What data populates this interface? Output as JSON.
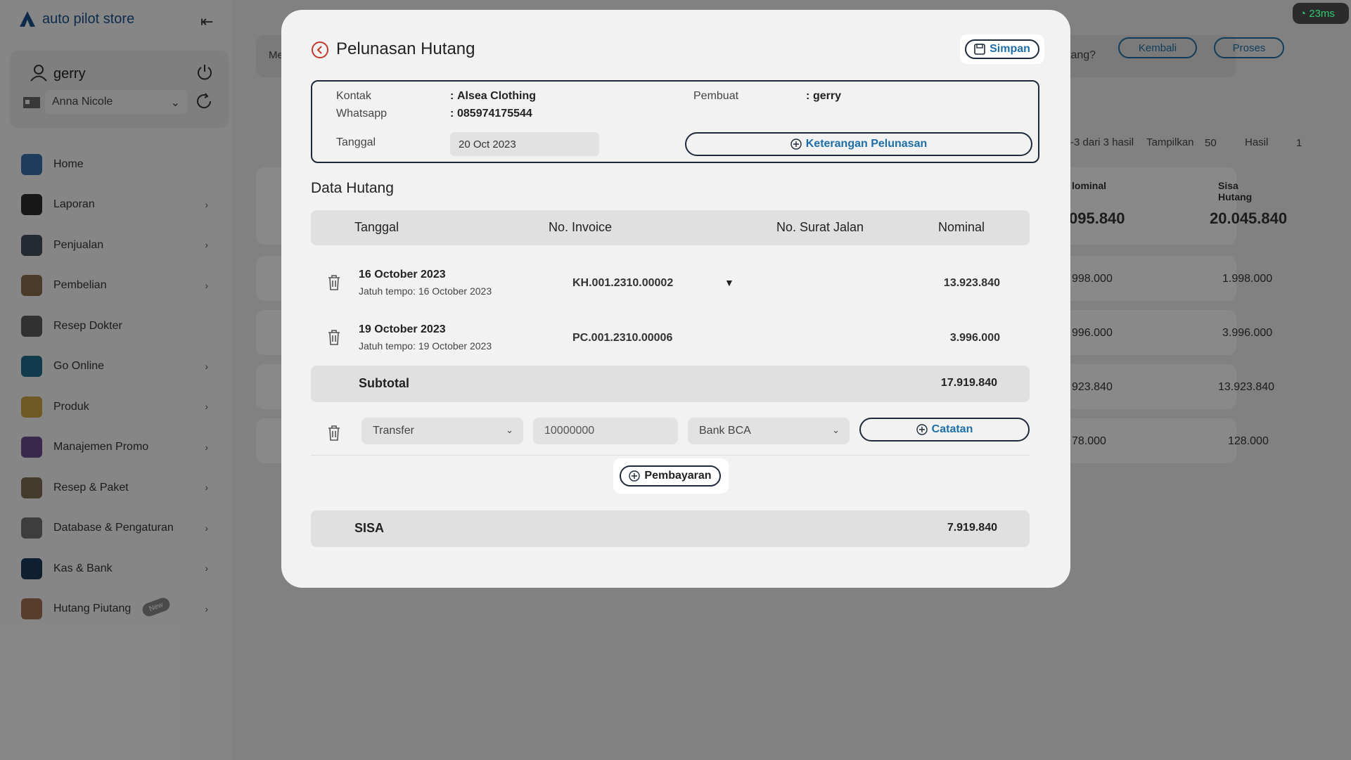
{
  "app": {
    "logo_text": "auto pilot store",
    "network": "23ms"
  },
  "user": {
    "name": "gerry",
    "store": "Anna Nicole"
  },
  "sidebar": {
    "items": [
      {
        "label": "Home",
        "icon": "home-icon",
        "color": "#3b6ea8",
        "arrow": false
      },
      {
        "label": "Laporan",
        "icon": "report-icon",
        "color": "#2a2a2a",
        "arrow": true
      },
      {
        "label": "Penjualan",
        "icon": "cashier-icon",
        "color": "#444c5a",
        "arrow": true
      },
      {
        "label": "Pembelian",
        "icon": "purchase-icon",
        "color": "#8a6a4a",
        "arrow": true
      },
      {
        "label": "Resep Dokter",
        "icon": "prescription-icon",
        "color": "#5a5a5a",
        "arrow": false
      },
      {
        "label": "Go Online",
        "icon": "monitor-icon",
        "color": "#1f6a8a",
        "arrow": true
      },
      {
        "label": "Produk",
        "icon": "box-icon",
        "color": "#c8a040",
        "arrow": true
      },
      {
        "label": "Manajemen Promo",
        "icon": "promo-icon",
        "color": "#6a4a8a",
        "arrow": true
      },
      {
        "label": "Resep & Paket",
        "icon": "mortar-icon",
        "color": "#7a6a50",
        "arrow": true
      },
      {
        "label": "Database & Pengaturan",
        "icon": "settings-icon",
        "color": "#707070",
        "arrow": true
      },
      {
        "label": "Kas & Bank",
        "icon": "bank-icon",
        "color": "#1a3a5a",
        "arrow": true
      },
      {
        "label": "Hutang Piutang",
        "icon": "debt-icon",
        "color": "#a07050",
        "arrow": true,
        "badge": "New"
      }
    ]
  },
  "background": {
    "head_fragment": "Me",
    "question": "tang?",
    "btn_back": "Kembali",
    "btn_process": "Proses",
    "range_text": "-3 dari 3 hasil",
    "show_label": "Tampilkan",
    "show_value": "50",
    "result_label": "Hasil",
    "result_value": "1",
    "col_nominal": "lominal",
    "col_sisa": "Sisa Hutang",
    "total_nominal": "095.840",
    "total_sisa": "20.045.840",
    "rows": [
      {
        "nominal": "998.000",
        "sisa": "1.998.000"
      },
      {
        "nominal": "996.000",
        "sisa": "3.996.000"
      },
      {
        "nominal": "923.840",
        "sisa": "13.923.840"
      },
      {
        "nominal": "78.000",
        "sisa": "128.000"
      }
    ]
  },
  "modal": {
    "title": "Pelunasan Hutang",
    "save_label": "Simpan",
    "info": {
      "kontak_label": "Kontak",
      "kontak_value": "Alsea Clothing",
      "whatsapp_label": "Whatsapp",
      "whatsapp_value": "085974175544",
      "tanggal_label": "Tanggal",
      "tanggal_value": "20 Oct 2023",
      "pembuat_label": "Pembuat",
      "pembuat_value": "gerry",
      "colon": ":",
      "keterangan_label": "Keterangan Pelunasan"
    },
    "section_title": "Data Hutang",
    "columns": [
      "Tanggal",
      "No. Invoice",
      "No. Surat Jalan",
      "Nominal"
    ],
    "invoices": [
      {
        "date": "16 October 2023",
        "due": "Jatuh tempo: 16 October 2023",
        "invoice": "KH.001.2310.00002",
        "has_dropdown": true,
        "nominal": "13.923.840"
      },
      {
        "date": "19 October 2023",
        "due": "Jatuh tempo: 19 October 2023",
        "invoice": "PC.001.2310.00006",
        "has_dropdown": false,
        "nominal": "3.996.000"
      }
    ],
    "subtotal_label": "Subtotal",
    "subtotal_value": "17.919.840",
    "payment": {
      "method": "Transfer",
      "amount": "10000000",
      "bank": "Bank BCA",
      "note_label": "Catatan"
    },
    "add_payment_label": "Pembayaran",
    "sisa_label": "SISA",
    "sisa_value": "7.919.840"
  }
}
